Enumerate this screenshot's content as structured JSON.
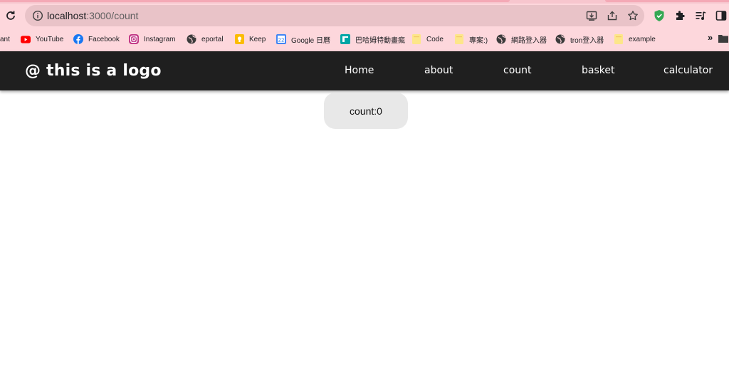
{
  "browser": {
    "url_host": "localhost",
    "url_path": ":3000/count",
    "bookmarks": [
      {
        "label": "ant",
        "icon": "none"
      },
      {
        "label": "YouTube",
        "icon": "youtube-icon"
      },
      {
        "label": "Facebook",
        "icon": "facebook-icon"
      },
      {
        "label": "Instagram",
        "icon": "instagram-icon"
      },
      {
        "label": "eportal",
        "icon": "globe-icon"
      },
      {
        "label": "Keep",
        "icon": "keep-icon"
      },
      {
        "label": "Google 日曆",
        "icon": "calendar-icon"
      },
      {
        "label": "巴哈姆特動畫瘋",
        "icon": "bahamut-icon"
      },
      {
        "label": "Code",
        "icon": "folder-icon"
      },
      {
        "label": "專案:)",
        "icon": "folder-icon"
      },
      {
        "label": "網路登入器",
        "icon": "globe-icon"
      },
      {
        "label": "tron登入器",
        "icon": "globe-icon"
      },
      {
        "label": "example",
        "icon": "folder-icon"
      }
    ],
    "more_label": "»",
    "colors": {
      "chrome_bg": "#fdd7dc",
      "omnibox_bg": "#e9c3c8"
    }
  },
  "app": {
    "logo": "@ this is a logo",
    "nav": [
      {
        "label": "Home"
      },
      {
        "label": "about"
      },
      {
        "label": "count"
      },
      {
        "label": "basket"
      },
      {
        "label": "calculator"
      }
    ],
    "colors": {
      "nav_bg": "#1f1f1f",
      "card_bg": "#e8e8e8"
    }
  },
  "content": {
    "count_text": "count:0"
  }
}
